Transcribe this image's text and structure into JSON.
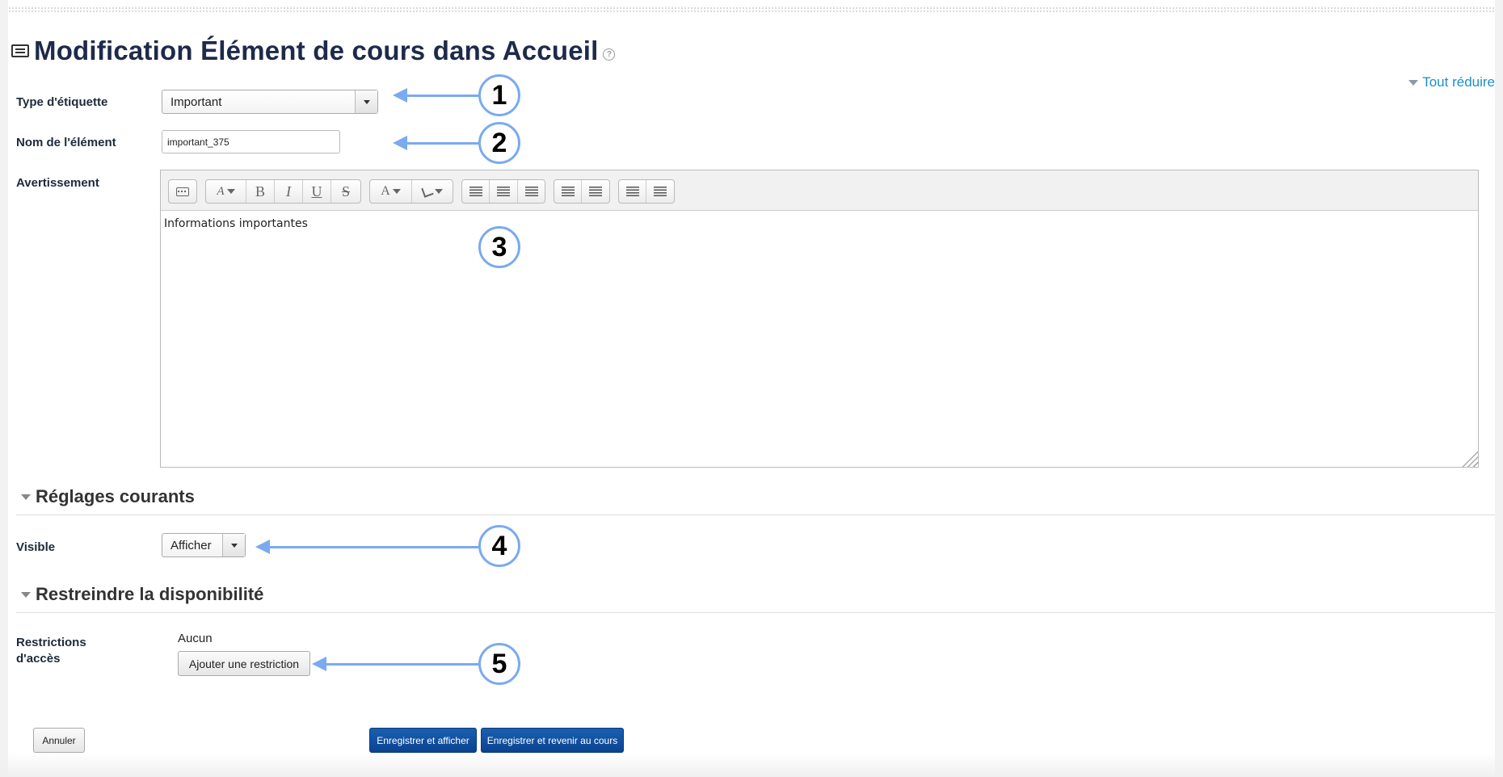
{
  "page": {
    "title": "Modification Élément de cours dans Accueil",
    "collapse_all": "Tout réduire"
  },
  "form": {
    "type_label": "Type d'étiquette",
    "type_value": "Important",
    "name_label": "Nom de l'élément",
    "name_value": "important_375",
    "warning_label": "Avertissement",
    "editor_content": "Informations importantes",
    "toolbar": {
      "bold": "B",
      "italic": "I",
      "underline": "U",
      "strike": "S",
      "font_size": "A",
      "font_color": "A"
    }
  },
  "sections": {
    "common": {
      "title": "Réglages courants",
      "visible_label": "Visible",
      "visible_value": "Afficher"
    },
    "restrict": {
      "title": "Restreindre la disponibilité",
      "access_label_line1": "Restrictions",
      "access_label_line2": "d'accès",
      "none_text": "Aucun",
      "add_button": "Ajouter une restriction"
    }
  },
  "actions": {
    "cancel": "Annuler",
    "save_display": "Enregistrer et afficher",
    "save_return": "Enregistrer et revenir au cours"
  },
  "annotations": [
    "1",
    "2",
    "3",
    "4",
    "5"
  ],
  "colors": {
    "annotation": "#7aaaf0",
    "link": "#1a8fc7",
    "primary_button": "#0b4390",
    "title": "#1e2a4a"
  }
}
